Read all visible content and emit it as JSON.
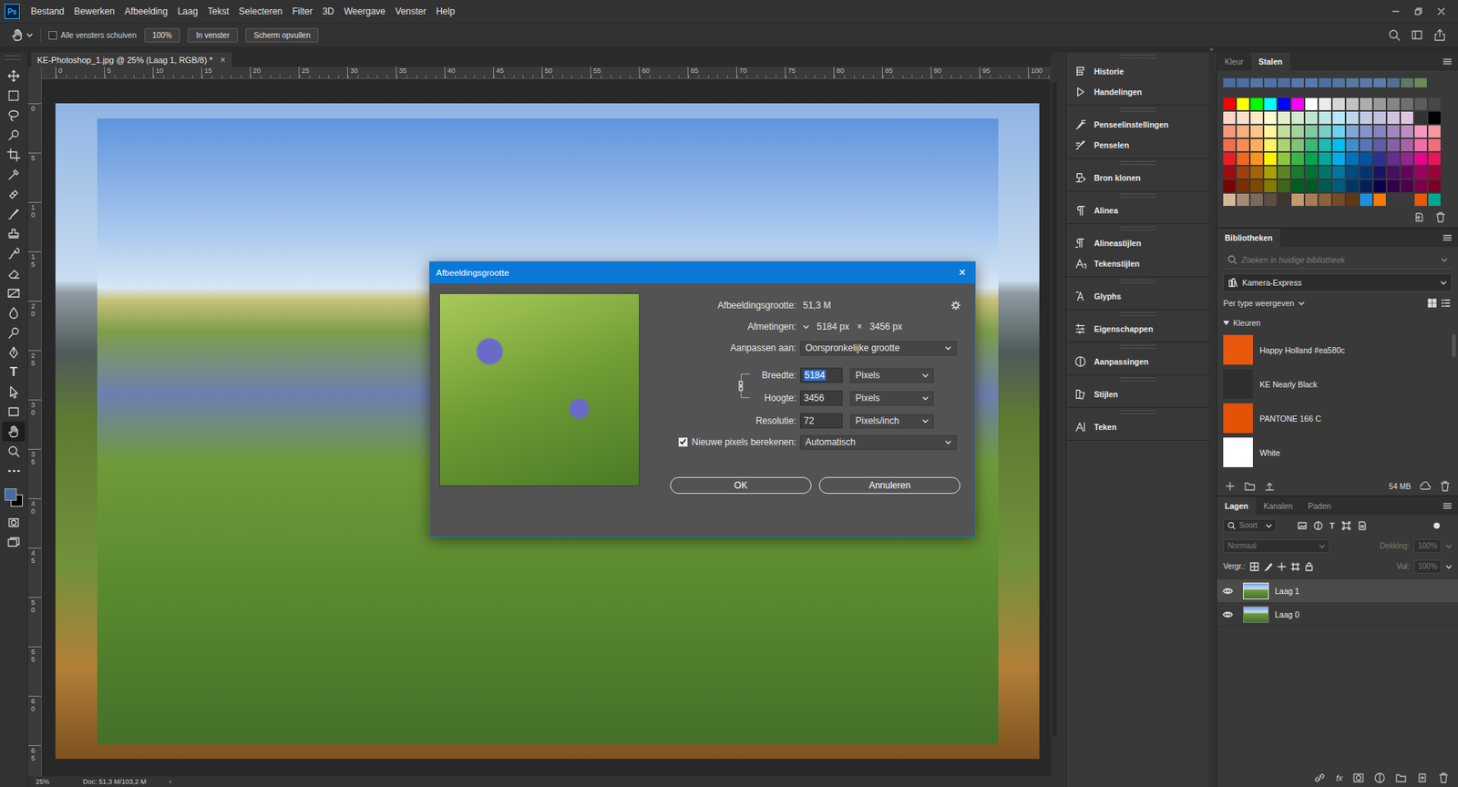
{
  "app": {
    "logo": "Ps"
  },
  "menu": [
    "Bestand",
    "Bewerken",
    "Afbeelding",
    "Laag",
    "Tekst",
    "Selecteren",
    "Filter",
    "3D",
    "Weergave",
    "Venster",
    "Help"
  ],
  "options_bar": {
    "scroll_all": {
      "label": "Alle vensters schuiven",
      "checked": false
    },
    "buttons": [
      "100%",
      "In venster",
      "Scherm opvullen"
    ]
  },
  "panel_toggle": "»",
  "tools": [
    {
      "selected": false
    },
    {
      "selected": false
    },
    {
      "selected": false
    },
    {
      "selected": false
    },
    {
      "selected": false
    },
    {
      "selected": false
    },
    {
      "selected": false
    },
    {
      "selected": false
    },
    {
      "selected": false
    },
    {
      "selected": false
    },
    {
      "selected": false
    },
    {
      "selected": false
    },
    {
      "selected": false
    },
    {
      "selected": false
    },
    {
      "selected": false
    },
    {
      "glyph": "T",
      "selected": false
    },
    {
      "selected": false
    },
    {
      "selected": false
    },
    {
      "selected": true
    },
    {
      "selected": false
    },
    {
      "selected": false
    }
  ],
  "colors": [
    {
      "kind": "background",
      "color": "#000000"
    },
    {
      "kind": "foreground",
      "color": "#4a6a9c"
    }
  ],
  "document": {
    "tab": "KE-Photoshop_1.jpg @ 25% (Laag 1, RGB/8) *",
    "close": "×"
  },
  "rulers": {
    "top": [
      "0",
      "5",
      "10",
      "15",
      "20",
      "25",
      "30",
      "35",
      "40",
      "45",
      "50",
      "55",
      "60",
      "65",
      "70",
      "75",
      "80",
      "85",
      "90",
      "95",
      "100"
    ],
    "left": [
      "0",
      "5",
      "10",
      "15",
      "20",
      "25",
      "30",
      "35",
      "40",
      "45",
      "50",
      "55",
      "60",
      "65"
    ]
  },
  "status_bar": {
    "zoom": "25%",
    "doc": "Doc: 51,3 M/103,2 M",
    "arrow": "›"
  },
  "dialog": {
    "title": "Afbeeldingsgrootte",
    "close": "×",
    "size": {
      "label": "Afbeeldingsgrootte:",
      "value": "51,3 M"
    },
    "dimensions": {
      "label": "Afmetingen:",
      "width": "5184 px",
      "times": "×",
      "height": "3456 px"
    },
    "fit": {
      "label": "Aanpassen aan:",
      "value": "Oorspronkelijke grootte"
    },
    "fields": [
      {
        "label": "Breedte:",
        "value": "5184",
        "unit": "Pixels",
        "selected": true
      },
      {
        "label": "Hoogte:",
        "value": "3456",
        "unit": "Pixels",
        "selected": false
      },
      {
        "label": "Resolutie:",
        "value": "72",
        "unit": "Pixels/inch",
        "selected": false
      }
    ],
    "constrained": true,
    "resample": {
      "label": "Nieuwe pixels berekenen:",
      "checked": true,
      "value": "Automatisch"
    },
    "buttons": [
      "OK",
      "Annuleren"
    ]
  },
  "dock": [
    {
      "items": [
        "Historie",
        "Handelingen"
      ]
    },
    {
      "items": [
        "Penseelinstellingen",
        "Penselen"
      ]
    },
    {
      "items": [
        "Bron klonen"
      ]
    },
    {
      "items": [
        "Alinea"
      ]
    },
    {
      "items": [
        "Alineastijlen",
        "Tekenstijlen"
      ]
    },
    {
      "items": [
        "Glyphs"
      ]
    },
    {
      "items": [
        "Eigenschappen"
      ]
    },
    {
      "items": [
        "Aanpassingen"
      ]
    },
    {
      "items": [
        "Stijlen"
      ]
    },
    {
      "items": [
        "Teken"
      ]
    }
  ],
  "swatches": {
    "tabs": [
      {
        "label": "Kleur",
        "selected": false
      },
      {
        "label": "Stalen",
        "selected": true
      }
    ],
    "recent": [
      "#4b6c9e",
      "#4d6ea1",
      "#5474a6",
      "#5072a4",
      "#4f6fa0",
      "#5677aa",
      "#5979ad",
      "#4e6f9f",
      "#54759f",
      "#57789f",
      "#5a7aa5",
      "#5b7ca8",
      "#4f7093",
      "#5a7a6a",
      "#6b8a5a"
    ],
    "rows": [
      [
        "#ff0000",
        "#ffff00",
        "#00ff00",
        "#00ffff",
        "#0000ff",
        "#ff00ff",
        "#ffffff",
        "#ebebeb",
        "#d6d6d6",
        "#c2c2c2",
        "#adadad",
        "#999999",
        "#858585",
        "#707070",
        "#5c5c5c",
        "#474747"
      ],
      [
        "#fcd4c8",
        "#fde0cc",
        "#fee8c8",
        "#fffbd0",
        "#e2efcd",
        "#d1e9cd",
        "#c1e4ce",
        "#bde6e3",
        "#b7e7fa",
        "#bfd3eb",
        "#c2c9e4",
        "#c4c0de",
        "#d0c3de",
        "#ddc6df",
        "#333333",
        "#000000"
      ],
      [
        "#f7977a",
        "#f9ad81",
        "#fdc68a",
        "#fff79a",
        "#c4df9b",
        "#a2d39c",
        "#82ca9d",
        "#7bcdc8",
        "#6ecff6",
        "#7ea7d8",
        "#8493ca",
        "#8882be",
        "#a187be",
        "#bc8dbf",
        "#f49ac2",
        "#f6989d"
      ],
      [
        "#f26c4f",
        "#f68e55",
        "#fbaf5c",
        "#fff467",
        "#acd372",
        "#7cc576",
        "#3bb878",
        "#1abbb4",
        "#00bff3",
        "#438cca",
        "#5574b9",
        "#605ca8",
        "#855fa8",
        "#a763a8",
        "#f06ea9",
        "#f26d7d"
      ],
      [
        "#ed1c24",
        "#f26522",
        "#f7941d",
        "#fff200",
        "#8dc73f",
        "#39b54a",
        "#00a651",
        "#00a99d",
        "#00aeef",
        "#0072bc",
        "#0054a6",
        "#2e3192",
        "#662d91",
        "#92278f",
        "#ec008c",
        "#ed145b"
      ],
      [
        "#9e0b0f",
        "#a0410d",
        "#a36209",
        "#aba000",
        "#598527",
        "#197b30",
        "#007236",
        "#00746b",
        "#0076a3",
        "#004b80",
        "#003471",
        "#1b1464",
        "#440e62",
        "#630460",
        "#9e005d",
        "#9e0039"
      ],
      [
        "#790000",
        "#7b2e00",
        "#7d4900",
        "#827b00",
        "#406618",
        "#005e20",
        "#005826",
        "#005952",
        "#005b7f",
        "#003663",
        "#002157",
        "#0d004c",
        "#32004b",
        "#4b0049",
        "#7b0046",
        "#7a0026"
      ],
      [
        "#d4b896",
        "#a38b72",
        "#7a6a5b",
        "#5d4e42",
        "#3d3530",
        "#c49a6c",
        "#a67c52",
        "#8c6239",
        "#754c24",
        "#603913",
        "#1e8fe0",
        "#f57c00",
        "#3a3a3a",
        "#3a3a3a",
        "#ea580c",
        "#00a88f"
      ]
    ]
  },
  "libraries": {
    "title": "Bibliotheken",
    "search_placeholder": "Zoeken in huidige bibliotheek",
    "library": "Kamera-Express",
    "view": "Per type weergeven",
    "section": {
      "label": "Kleuren",
      "expanded": true
    },
    "items": [
      {
        "name": "Happy Holland #ea580c",
        "color": "#ea580c"
      },
      {
        "name": "KE Nearly Black",
        "color": "#2e2e2e"
      },
      {
        "name": "PANTONE 166 C",
        "color": "#e35205"
      },
      {
        "name": "White",
        "color": "#ffffff"
      }
    ],
    "storage": "54 MB"
  },
  "layers": {
    "tabs": [
      {
        "label": "Lagen",
        "selected": true
      },
      {
        "label": "Kanalen",
        "selected": false
      },
      {
        "label": "Paden",
        "selected": false
      }
    ],
    "filter_placeholder": "Soort",
    "filter_glyph": "T",
    "blend": "Normaal",
    "opacity_label": "Dekking:",
    "opacity": "100%",
    "lock_label": "Vergr.:",
    "fill_label": "Vul:",
    "fill": "100%",
    "options_disabled": true,
    "rows": [
      {
        "name": "Laag 1",
        "visible": true,
        "selected": true
      },
      {
        "name": "Laag 0",
        "visible": true,
        "selected": false
      }
    ],
    "fx": "fx"
  }
}
